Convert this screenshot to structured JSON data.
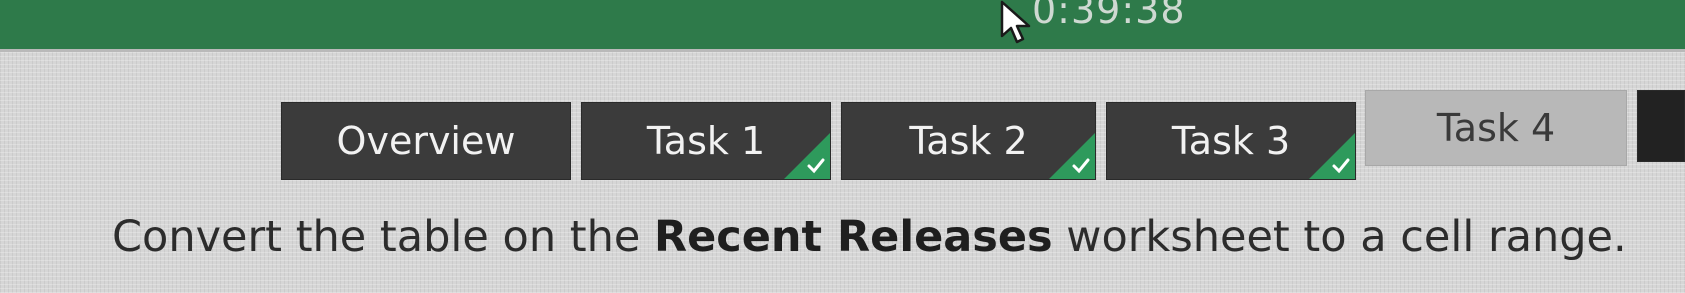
{
  "header": {
    "timer": "0:39:38",
    "accent_color": "#2e7a4a"
  },
  "tabs": [
    {
      "label": "Overview",
      "completed": false,
      "active": false
    },
    {
      "label": "Task 1",
      "completed": true,
      "active": false
    },
    {
      "label": "Task 2",
      "completed": true,
      "active": false
    },
    {
      "label": "Task 3",
      "completed": true,
      "active": false
    },
    {
      "label": "Task 4",
      "completed": false,
      "active": true
    }
  ],
  "task": {
    "text_before": "Convert the table on the ",
    "bold_text": "Recent Releases",
    "text_after": " worksheet to a cell range."
  },
  "icons": {
    "check": "check-icon",
    "cursor": "mouse-cursor-icon"
  },
  "colors": {
    "tab_bg": "#3b3b3b",
    "tab_active_bg": "#b8b8b8",
    "check_green": "#2e9a5c"
  }
}
